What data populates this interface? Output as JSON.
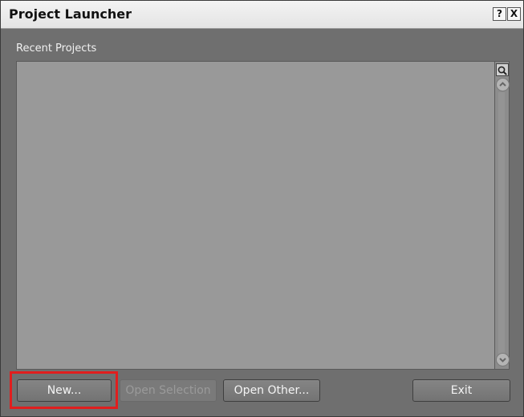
{
  "window": {
    "title": "Project Launcher",
    "help_label": "?",
    "close_label": "X"
  },
  "recent": {
    "label": "Recent Projects",
    "items": []
  },
  "buttons": {
    "new_label": "New...",
    "open_selection_label": "Open Selection",
    "open_other_label": "Open Other...",
    "exit_label": "Exit"
  },
  "colors": {
    "background": "#6f6f6f",
    "list_bg": "#999999",
    "highlight": "#e11e1e"
  }
}
